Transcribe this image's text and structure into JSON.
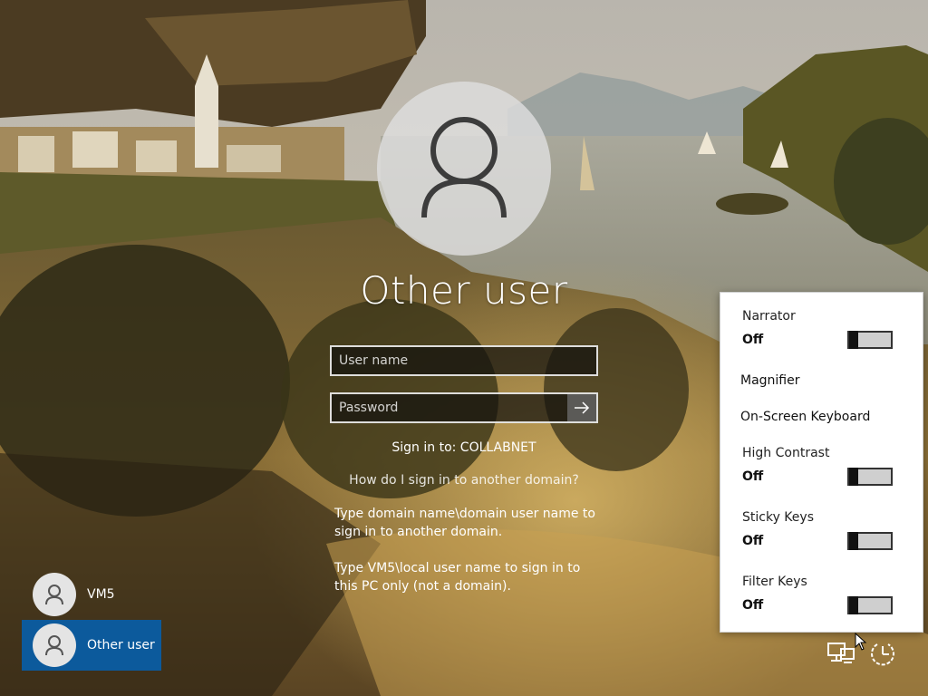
{
  "login": {
    "title": "Other user",
    "username_placeholder": "User name",
    "password_placeholder": "Password",
    "signin_to": "Sign in to: COLLABNET",
    "help_link": "How do I sign in to another domain?",
    "help_text_domain": "Type domain name\\domain user name to sign in to another domain.",
    "help_text_local": "Type VM5\\local user name to sign in to this PC only (not a domain)."
  },
  "users": [
    {
      "name": "VM5",
      "selected": false
    },
    {
      "name": "Other user",
      "selected": true
    }
  ],
  "ease_of_access": {
    "narrator": {
      "label": "Narrator",
      "state": "Off"
    },
    "magnifier": {
      "label": "Magnifier"
    },
    "onscreen_keyboard": {
      "label": "On-Screen Keyboard"
    },
    "high_contrast": {
      "label": "High Contrast",
      "state": "Off"
    },
    "sticky_keys": {
      "label": "Sticky Keys",
      "state": "Off"
    },
    "filter_keys": {
      "label": "Filter Keys",
      "state": "Off"
    }
  },
  "icons": {
    "submit": "arrow-right-icon",
    "network": "network-icon",
    "power": "power-icon",
    "avatar": "person-icon"
  },
  "colors": {
    "selected_user": "#0c5a9c",
    "panel_background": "#ffffff"
  }
}
